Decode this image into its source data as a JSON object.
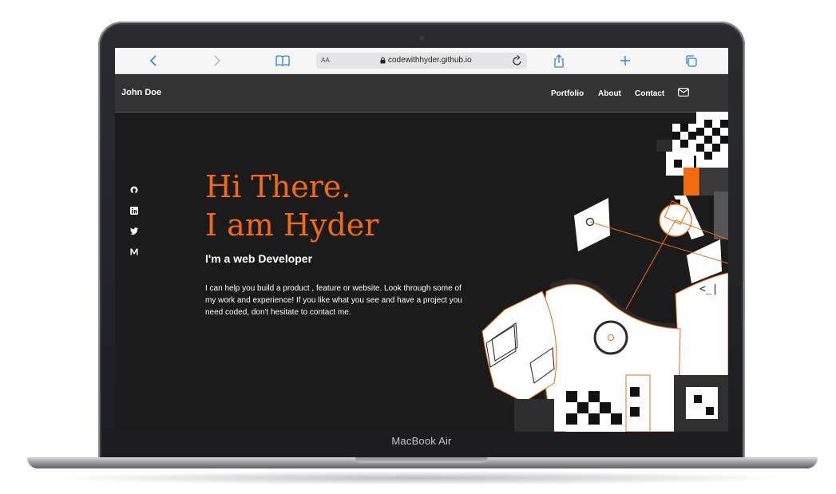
{
  "browser": {
    "text_size_label": "AA",
    "url": "codewithhyder.github.io"
  },
  "site": {
    "brand": "John Doe",
    "nav": [
      "Portfolio",
      "About",
      "Contact"
    ]
  },
  "hero": {
    "title_line1": "Hi There.",
    "title_line2": "I am Hyder",
    "subtitle": "I'm a web Developer",
    "description": "I can help you build a product , feature or website. Look through some of my work and experience! If you like what you see and have a project you need coded, don't hesitate to contact me.",
    "code_glyph": "<_|"
  },
  "social": [
    "github-icon",
    "linkedin-icon",
    "twitter-icon",
    "medium-icon"
  ],
  "device": {
    "label": "MacBook Air"
  },
  "colors": {
    "accent": "#f56a0f",
    "background": "#1b1b1b",
    "nav": "#333333"
  }
}
